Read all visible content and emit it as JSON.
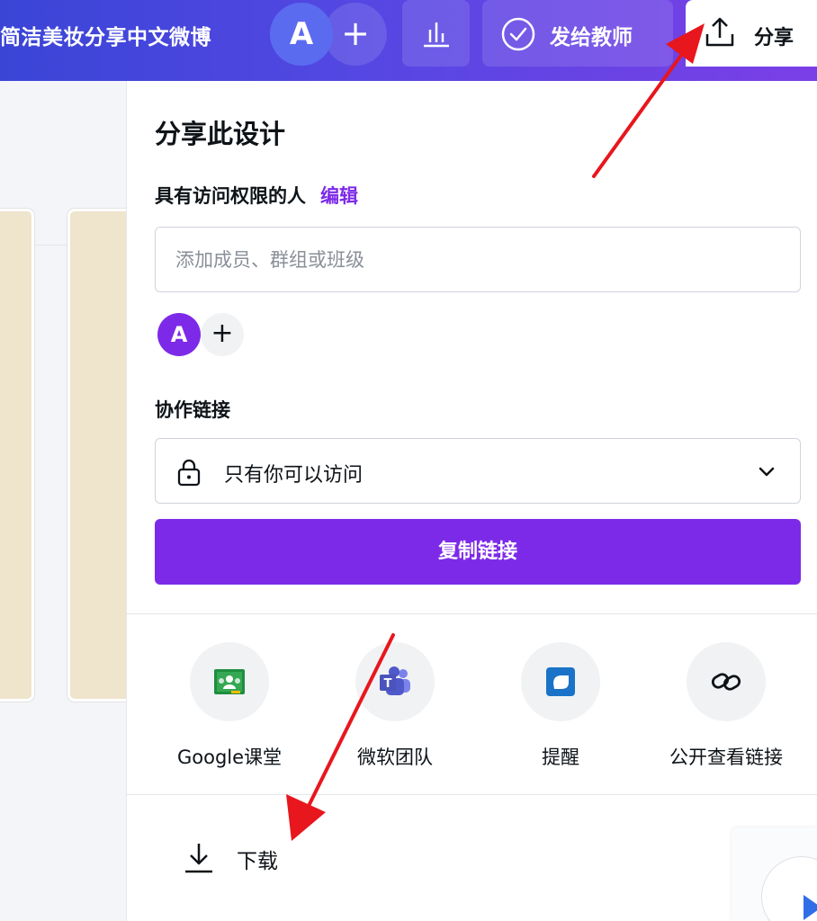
{
  "topbar": {
    "doc_title": "简洁美妆分享中文微博",
    "avatar_initial": "A",
    "add_label": "+",
    "analytics_icon": "bar-chart-icon",
    "send_teacher_label": "发给教师",
    "share_label": "分享"
  },
  "share_panel": {
    "title": "分享此设计",
    "access_label": "具有访问权限的人",
    "edit_link": "编辑",
    "member_input_placeholder": "添加成员、群组或班级",
    "member_avatar_initial": "A",
    "add_member_label": "+",
    "collab_link_label": "协作链接",
    "access_select_value": "只有你可以访问",
    "copy_link_button": "复制链接",
    "share_targets": [
      {
        "label": "Google课堂",
        "icon": "google-classroom-icon"
      },
      {
        "label": "微软团队",
        "icon": "microsoft-teams-icon"
      },
      {
        "label": "提醒",
        "icon": "reminder-icon"
      },
      {
        "label": "公开查看链接",
        "icon": "link-icon"
      }
    ],
    "download_label": "下载"
  },
  "colors": {
    "accent": "#7d2ae8",
    "topbar_start": "#3a45d6",
    "topbar_end": "#7b3fe6",
    "annotation_arrow": "#e8161d"
  }
}
